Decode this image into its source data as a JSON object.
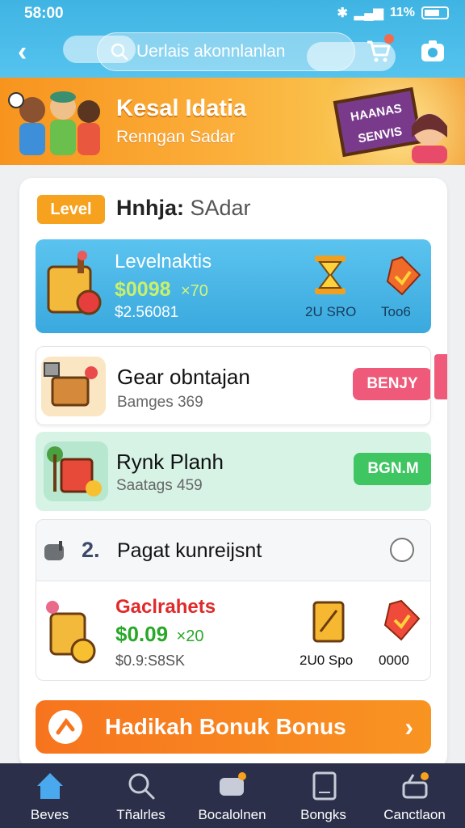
{
  "status": {
    "time": "58:00",
    "signal_text": "11%"
  },
  "header": {
    "search_placeholder": "Uerlais akonnlanlan"
  },
  "banner": {
    "title": "Kesal Idatia",
    "subtitle": "Renngan Sadar",
    "sign_text": "HAANAS SENVIS"
  },
  "level": {
    "badge": "Level",
    "title_bold": "Hnhja:",
    "title_light": " SAdar"
  },
  "featured": {
    "name": "Levelnaktis",
    "price": "$0098",
    "multiplier": "×70",
    "subprice": "$2.56081",
    "stat1": "2U SRO",
    "stat2": "Too6"
  },
  "items": [
    {
      "name": "Gear obntajan",
      "sub": "Bamges 369",
      "button": "BENJY",
      "button_color": "#ef5a7a"
    },
    {
      "name": "Rynk Planh",
      "sub": "Saatags 459",
      "button": "BGN.M",
      "button_color": "#3fc561"
    }
  ],
  "list": {
    "header_num": "2.",
    "header_title": "Pagat kunreijsnt",
    "item_name": "Gaclrahets",
    "item_price": "$0.09",
    "item_multiplier": "×20",
    "item_sub": "$0.9:S8SK",
    "stat1": "2U0 Spo",
    "stat2": "0000"
  },
  "bonus": {
    "label": "Hadikah Bonuk Bonus"
  },
  "nav": [
    {
      "label": "Beves"
    },
    {
      "label": "Tñalrles"
    },
    {
      "label": "Bocalolnen"
    },
    {
      "label": "Bongks"
    },
    {
      "label": "Canctlaon"
    }
  ],
  "colors": {
    "accent_blue": "#3fb4e3",
    "orange": "#f7741e",
    "nav_bg": "#2b2f49"
  }
}
